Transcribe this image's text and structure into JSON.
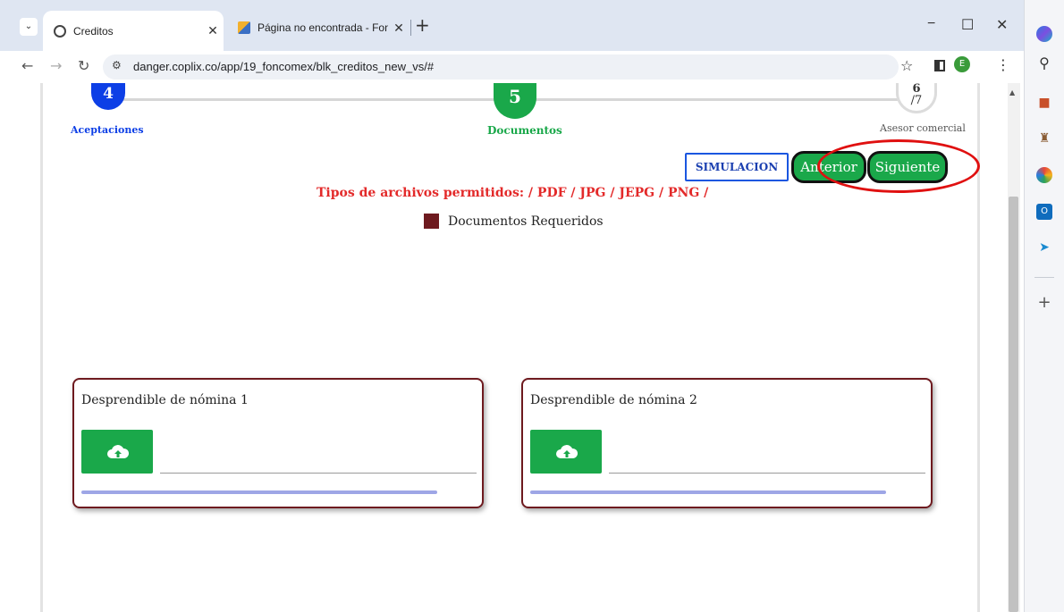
{
  "browser": {
    "tabs": [
      {
        "title": "Creditos",
        "close": "✕"
      },
      {
        "title": "Página no encontrada - Foncom",
        "close": "✕"
      }
    ],
    "new_tab": "+",
    "window_controls": {
      "minimize": "−",
      "maximize": "☐",
      "close": "✕"
    },
    "url": "danger.coplix.co/app/19_foncomex/blk_creditos_new_vs/#",
    "profile_initial": "E"
  },
  "stepper": {
    "steps": [
      {
        "number": "4",
        "label": "Aceptaciones",
        "color": "#0d3fe6"
      },
      {
        "number": "5",
        "label": "Documentos",
        "color": "#1aa84a"
      },
      {
        "number": "6",
        "total": "/7",
        "label": "Asesor comercial"
      }
    ]
  },
  "actions": {
    "simulacion": "SIMULACION",
    "anterior": "Anterior",
    "siguiente": "Siguiente",
    "highlight_color": "#e01010"
  },
  "file_types": "Tipos de archivos permitidos: / PDF / JPG / JEPG / PNG /",
  "legend": {
    "label": "Documentos Requeridos",
    "color": "#6e1a1f"
  },
  "documents": [
    {
      "title": "Desprendible de nómina 1",
      "upload_icon": "cloud-upload-icon"
    },
    {
      "title": "Desprendible de nómina 2",
      "upload_icon": "cloud-upload-icon"
    }
  ]
}
